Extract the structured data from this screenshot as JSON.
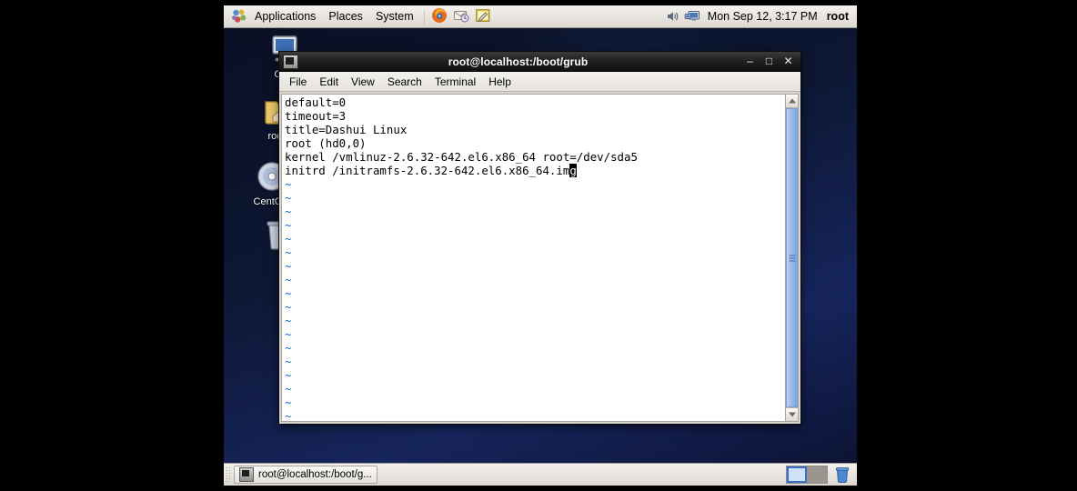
{
  "top_panel": {
    "menus": [
      {
        "label": "Applications",
        "icon": "gnome-foot-icon"
      },
      {
        "label": "Places",
        "icon": null
      },
      {
        "label": "System",
        "icon": null
      }
    ],
    "launchers": [
      {
        "name": "firefox-icon",
        "title": "Firefox Web Browser"
      },
      {
        "name": "evolution-mail-icon",
        "title": "Evolution Mail"
      },
      {
        "name": "text-editor-icon",
        "title": "Text Editor"
      }
    ],
    "tray": [
      {
        "name": "volume-icon"
      },
      {
        "name": "display-icon"
      }
    ],
    "clock": "Mon Sep 12,  3:17 PM",
    "user": "root"
  },
  "desktop": {
    "icons": [
      {
        "name": "computer-icon",
        "label": "Co...",
        "glyph": "computer"
      },
      {
        "name": "root-home-icon",
        "label": "roo...",
        "glyph": "folder-home"
      },
      {
        "name": "centos-media-icon",
        "label": "CentO...",
        "glyph": "disc"
      },
      {
        "name": "trash-desktop-icon",
        "label": "",
        "glyph": "trash"
      }
    ]
  },
  "terminal": {
    "title": "root@localhost:/boot/grub",
    "titlebar_icon": "terminal-icon",
    "window_buttons": [
      {
        "name": "minimize-button",
        "glyph": "–"
      },
      {
        "name": "maximize-button",
        "glyph": "□"
      },
      {
        "name": "close-button",
        "glyph": "✕"
      }
    ],
    "menus": [
      "File",
      "Edit",
      "View",
      "Search",
      "Terminal",
      "Help"
    ],
    "content_lines": [
      "default=0",
      "timeout=3",
      "title=Dashui Linux",
      "root (hd0,0)",
      "kernel /vmlinuz-2.6.32-642.el6.x86_64 root=/dev/sda5"
    ],
    "cursor_line": {
      "before": "initrd /initramfs-2.6.32-642.el6.x86_64.im",
      "cursor_char": "g",
      "after": ""
    },
    "tilde_char": "~",
    "tilde_count": 18,
    "colors": {
      "background": "#ffffff",
      "foreground": "#000000",
      "tilde": "#1e68c8",
      "cursor": "#000000"
    },
    "scrollbar": {
      "up_arrow": "scroll-up-arrow",
      "down_arrow": "scroll-down-arrow",
      "thumb_position": "full"
    }
  },
  "bottom_panel": {
    "task_button": {
      "label": "root@localhost:/boot/g...",
      "icon": "terminal-icon"
    },
    "workspaces": [
      {
        "name": "workspace-1",
        "active": true
      },
      {
        "name": "workspace-2",
        "active": false
      }
    ],
    "trash": {
      "name": "trash-icon"
    }
  }
}
